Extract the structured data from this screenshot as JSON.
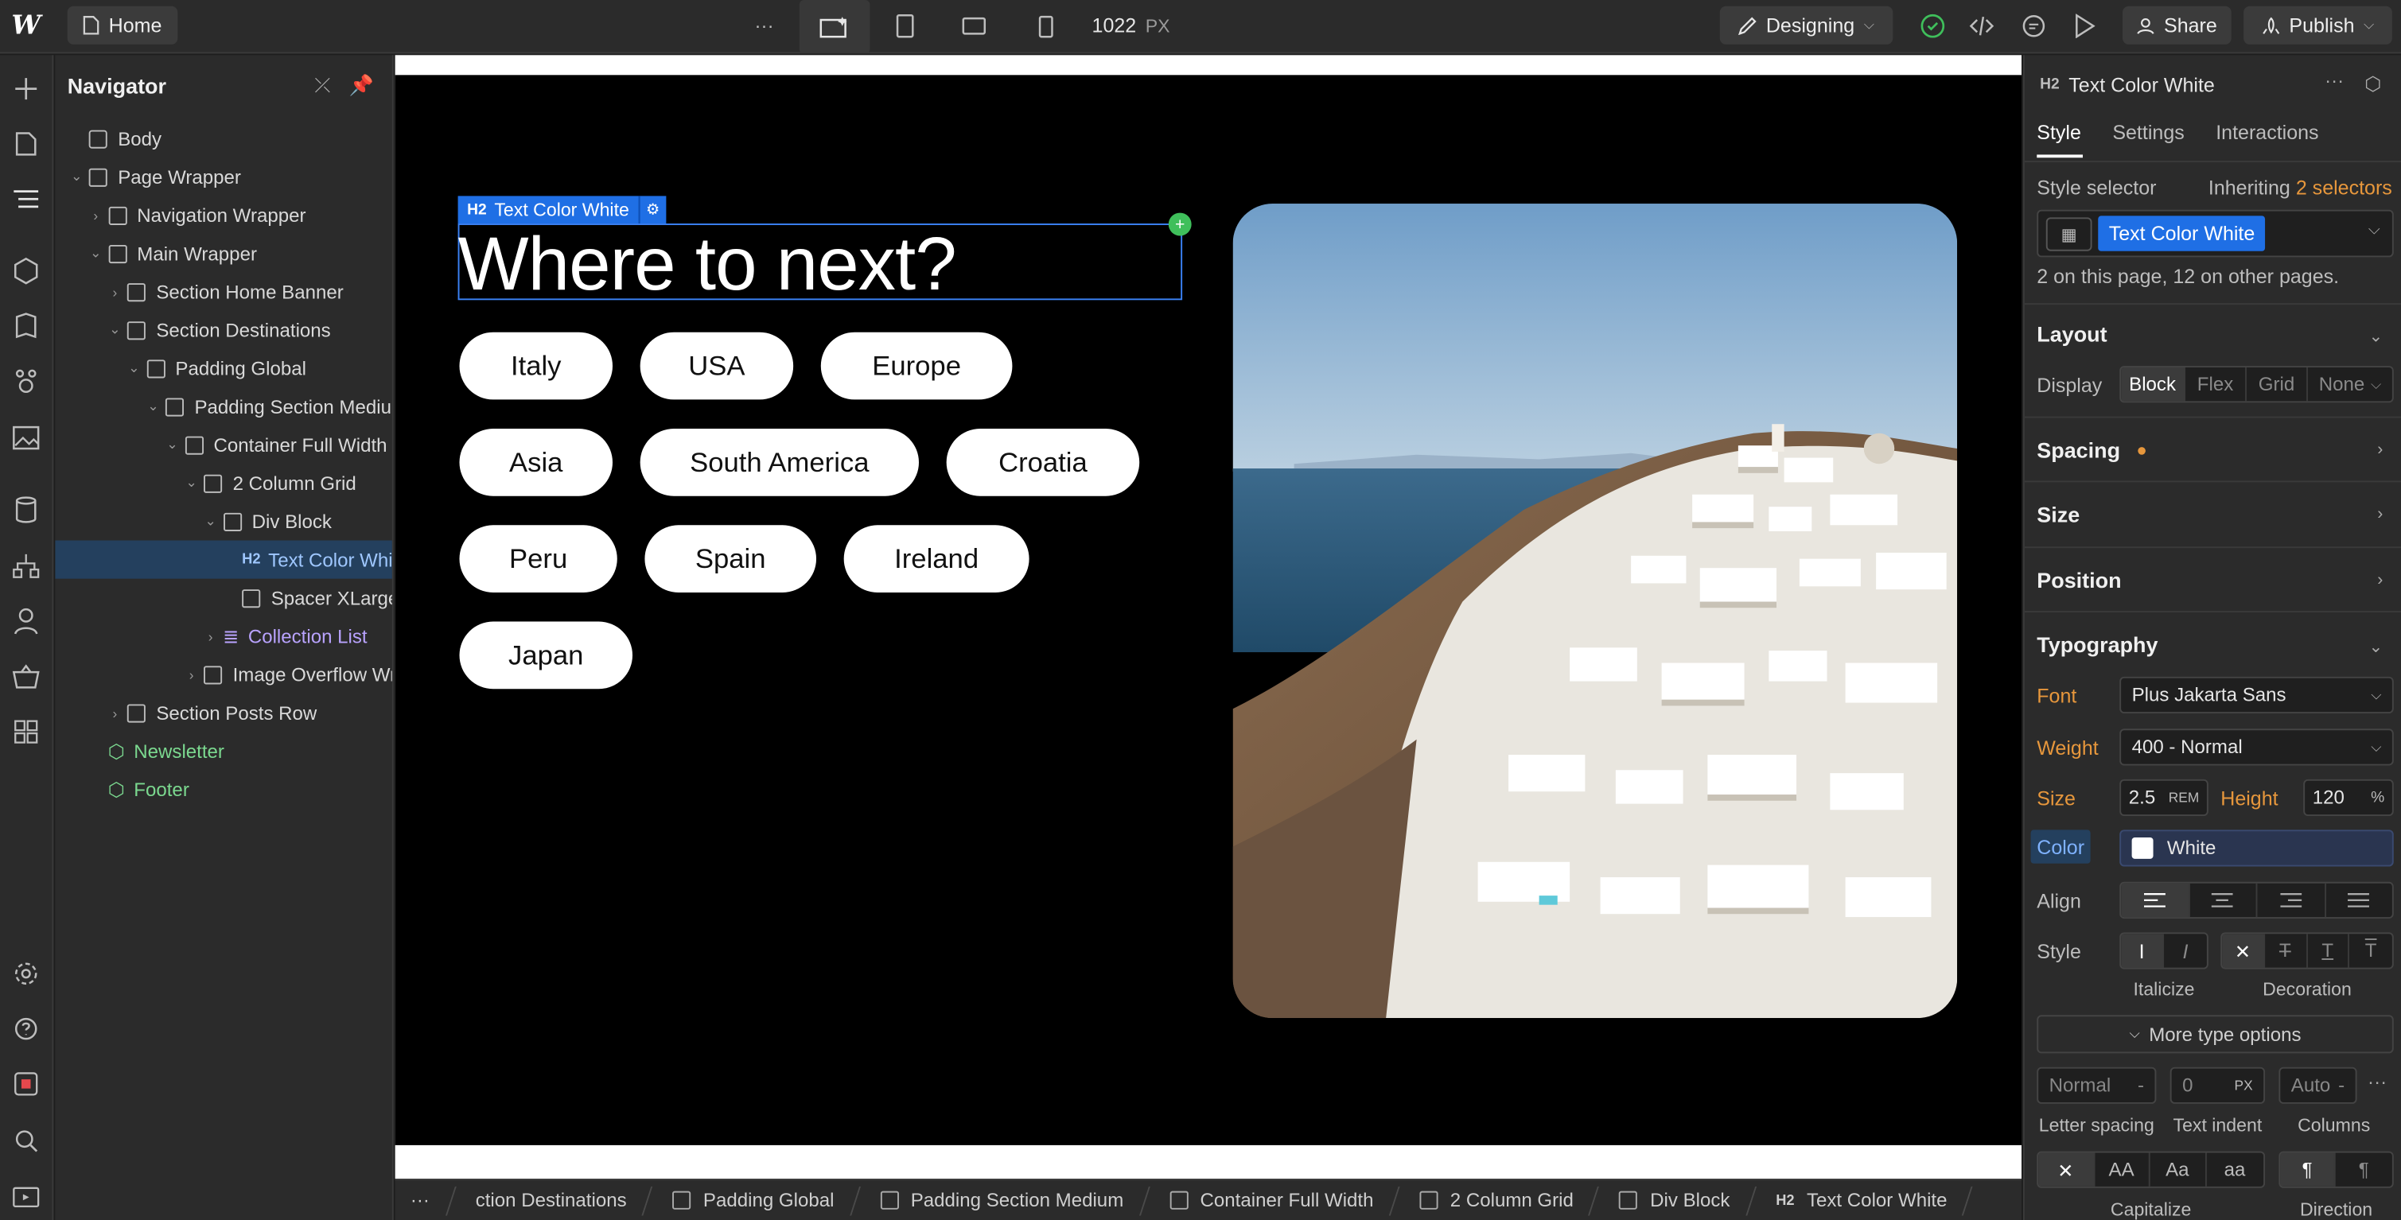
{
  "topbar": {
    "logo": "W",
    "page_tab": "Home",
    "more_glyph": "···",
    "width_value": "1022",
    "width_unit": "PX",
    "mode": "Designing",
    "share": "Share",
    "publish": "Publish"
  },
  "navigator": {
    "title": "Navigator",
    "tree": [
      {
        "label": "Body",
        "depth": 0,
        "caret": "",
        "kind": "body"
      },
      {
        "label": "Page Wrapper",
        "depth": 0,
        "caret": "open",
        "kind": "box"
      },
      {
        "label": "Navigation Wrapper",
        "depth": 1,
        "caret": "closed",
        "kind": "box"
      },
      {
        "label": "Main Wrapper",
        "depth": 1,
        "caret": "open",
        "kind": "box"
      },
      {
        "label": "Section Home Banner",
        "depth": 2,
        "caret": "closed",
        "kind": "box"
      },
      {
        "label": "Section Destinations",
        "depth": 2,
        "caret": "open",
        "kind": "box"
      },
      {
        "label": "Padding Global",
        "depth": 3,
        "caret": "open",
        "kind": "box"
      },
      {
        "label": "Padding Section Medium",
        "depth": 4,
        "caret": "open",
        "kind": "box"
      },
      {
        "label": "Container Full Width",
        "depth": 5,
        "caret": "open",
        "kind": "box"
      },
      {
        "label": "2 Column Grid",
        "depth": 6,
        "caret": "open",
        "kind": "box"
      },
      {
        "label": "Div Block",
        "depth": 7,
        "caret": "open",
        "kind": "box"
      },
      {
        "label": "Text Color White",
        "depth": 8,
        "caret": "",
        "kind": "h2",
        "selected": true
      },
      {
        "label": "Spacer XLarge",
        "depth": 8,
        "caret": "",
        "kind": "box"
      },
      {
        "label": "Collection List",
        "depth": 7,
        "caret": "closed",
        "kind": "collection"
      },
      {
        "label": "Image Overflow Wrapper",
        "depth": 6,
        "caret": "closed",
        "kind": "box"
      },
      {
        "label": "Section Posts Row",
        "depth": 2,
        "caret": "closed",
        "kind": "box"
      },
      {
        "label": "Newsletter",
        "depth": 1,
        "caret": "",
        "kind": "component"
      },
      {
        "label": "Footer",
        "depth": 1,
        "caret": "",
        "kind": "component"
      }
    ]
  },
  "canvas": {
    "selected_tag": "H2",
    "selected_label": "Text Color White",
    "heading": "Where to next?",
    "destinations": [
      "Italy",
      "USA",
      "Europe",
      "Asia",
      "South America",
      "Croatia",
      "Peru",
      "Spain",
      "Ireland",
      "Japan"
    ]
  },
  "breadcrumbs": [
    {
      "label": "ction Destinations",
      "kind": "text"
    },
    {
      "label": "Padding Global",
      "kind": "box"
    },
    {
      "label": "Padding Section Medium",
      "kind": "box"
    },
    {
      "label": "Container Full Width",
      "kind": "box"
    },
    {
      "label": "2 Column Grid",
      "kind": "box"
    },
    {
      "label": "Div Block",
      "kind": "box"
    },
    {
      "label": "Text Color White",
      "kind": "h2"
    }
  ],
  "panel": {
    "element_tag": "H2",
    "element_name": "Text Color White",
    "tabs": [
      "Style",
      "Settings",
      "Interactions"
    ],
    "style_selector_label": "Style selector",
    "inheriting_prefix": "Inheriting",
    "inheriting_count": "2 selectors",
    "selector_chip": "Text Color White",
    "usage_note": "2 on this page, 12 on other pages.",
    "layout_title": "Layout",
    "display_label": "Display",
    "display_options": [
      "Block",
      "Flex",
      "Grid",
      "None"
    ],
    "display_active": "Block",
    "spacing_title": "Spacing",
    "size_title": "Size",
    "position_title": "Position",
    "typography_title": "Typography",
    "font_label": "Font",
    "font_value": "Plus Jakarta Sans",
    "weight_label": "Weight",
    "weight_value": "400 - Normal",
    "size_label": "Size",
    "size_value": "2.5",
    "size_unit": "REM",
    "height_label": "Height",
    "height_value": "120",
    "height_unit": "%",
    "color_label": "Color",
    "color_value": "White",
    "align_label": "Align",
    "style_label": "Style",
    "italicize_caption": "Italicize",
    "decoration_caption": "Decoration",
    "more_type_options": "More type options",
    "letter_spacing_value": "Normal",
    "text_indent_value": "0",
    "text_indent_unit": "PX",
    "columns_value": "Auto",
    "letter_spacing_caption": "Letter spacing",
    "text_indent_caption": "Text indent",
    "columns_caption": "Columns",
    "capitalize_options": [
      "AA",
      "Aa",
      "aa"
    ],
    "capitalize_caption": "Capitalize",
    "direction_caption": "Direction"
  },
  "colors": {
    "accent_blue": "#1f6fe5",
    "panel_bg": "#2b2b2b",
    "orange_override": "#e7973c",
    "component_green": "#7bd88f"
  }
}
